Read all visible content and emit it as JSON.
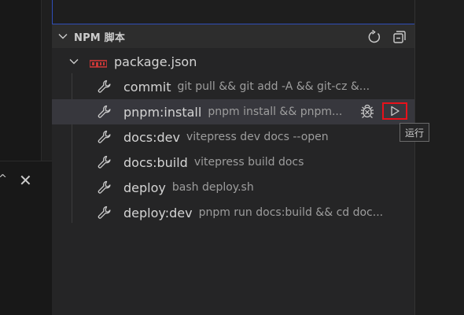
{
  "section": {
    "title": "NPM 脚本"
  },
  "tree": {
    "package": "package.json",
    "scripts": [
      {
        "name": "commit",
        "command": "git pull && git add -A && git-cz &..."
      },
      {
        "name": "pnpm:install",
        "command": "pnpm install && pnpm..."
      },
      {
        "name": "docs:dev",
        "command": "vitepress dev docs --open"
      },
      {
        "name": "docs:build",
        "command": "vitepress build docs"
      },
      {
        "name": "deploy",
        "command": "bash deploy.sh"
      },
      {
        "name": "deploy:dev",
        "command": "pnpm run docs:build && cd doc..."
      }
    ]
  },
  "tooltip": "运行",
  "colors": {
    "highlight": "#e8111b",
    "selection": "#37373d",
    "npm_red": "#cb3837"
  }
}
